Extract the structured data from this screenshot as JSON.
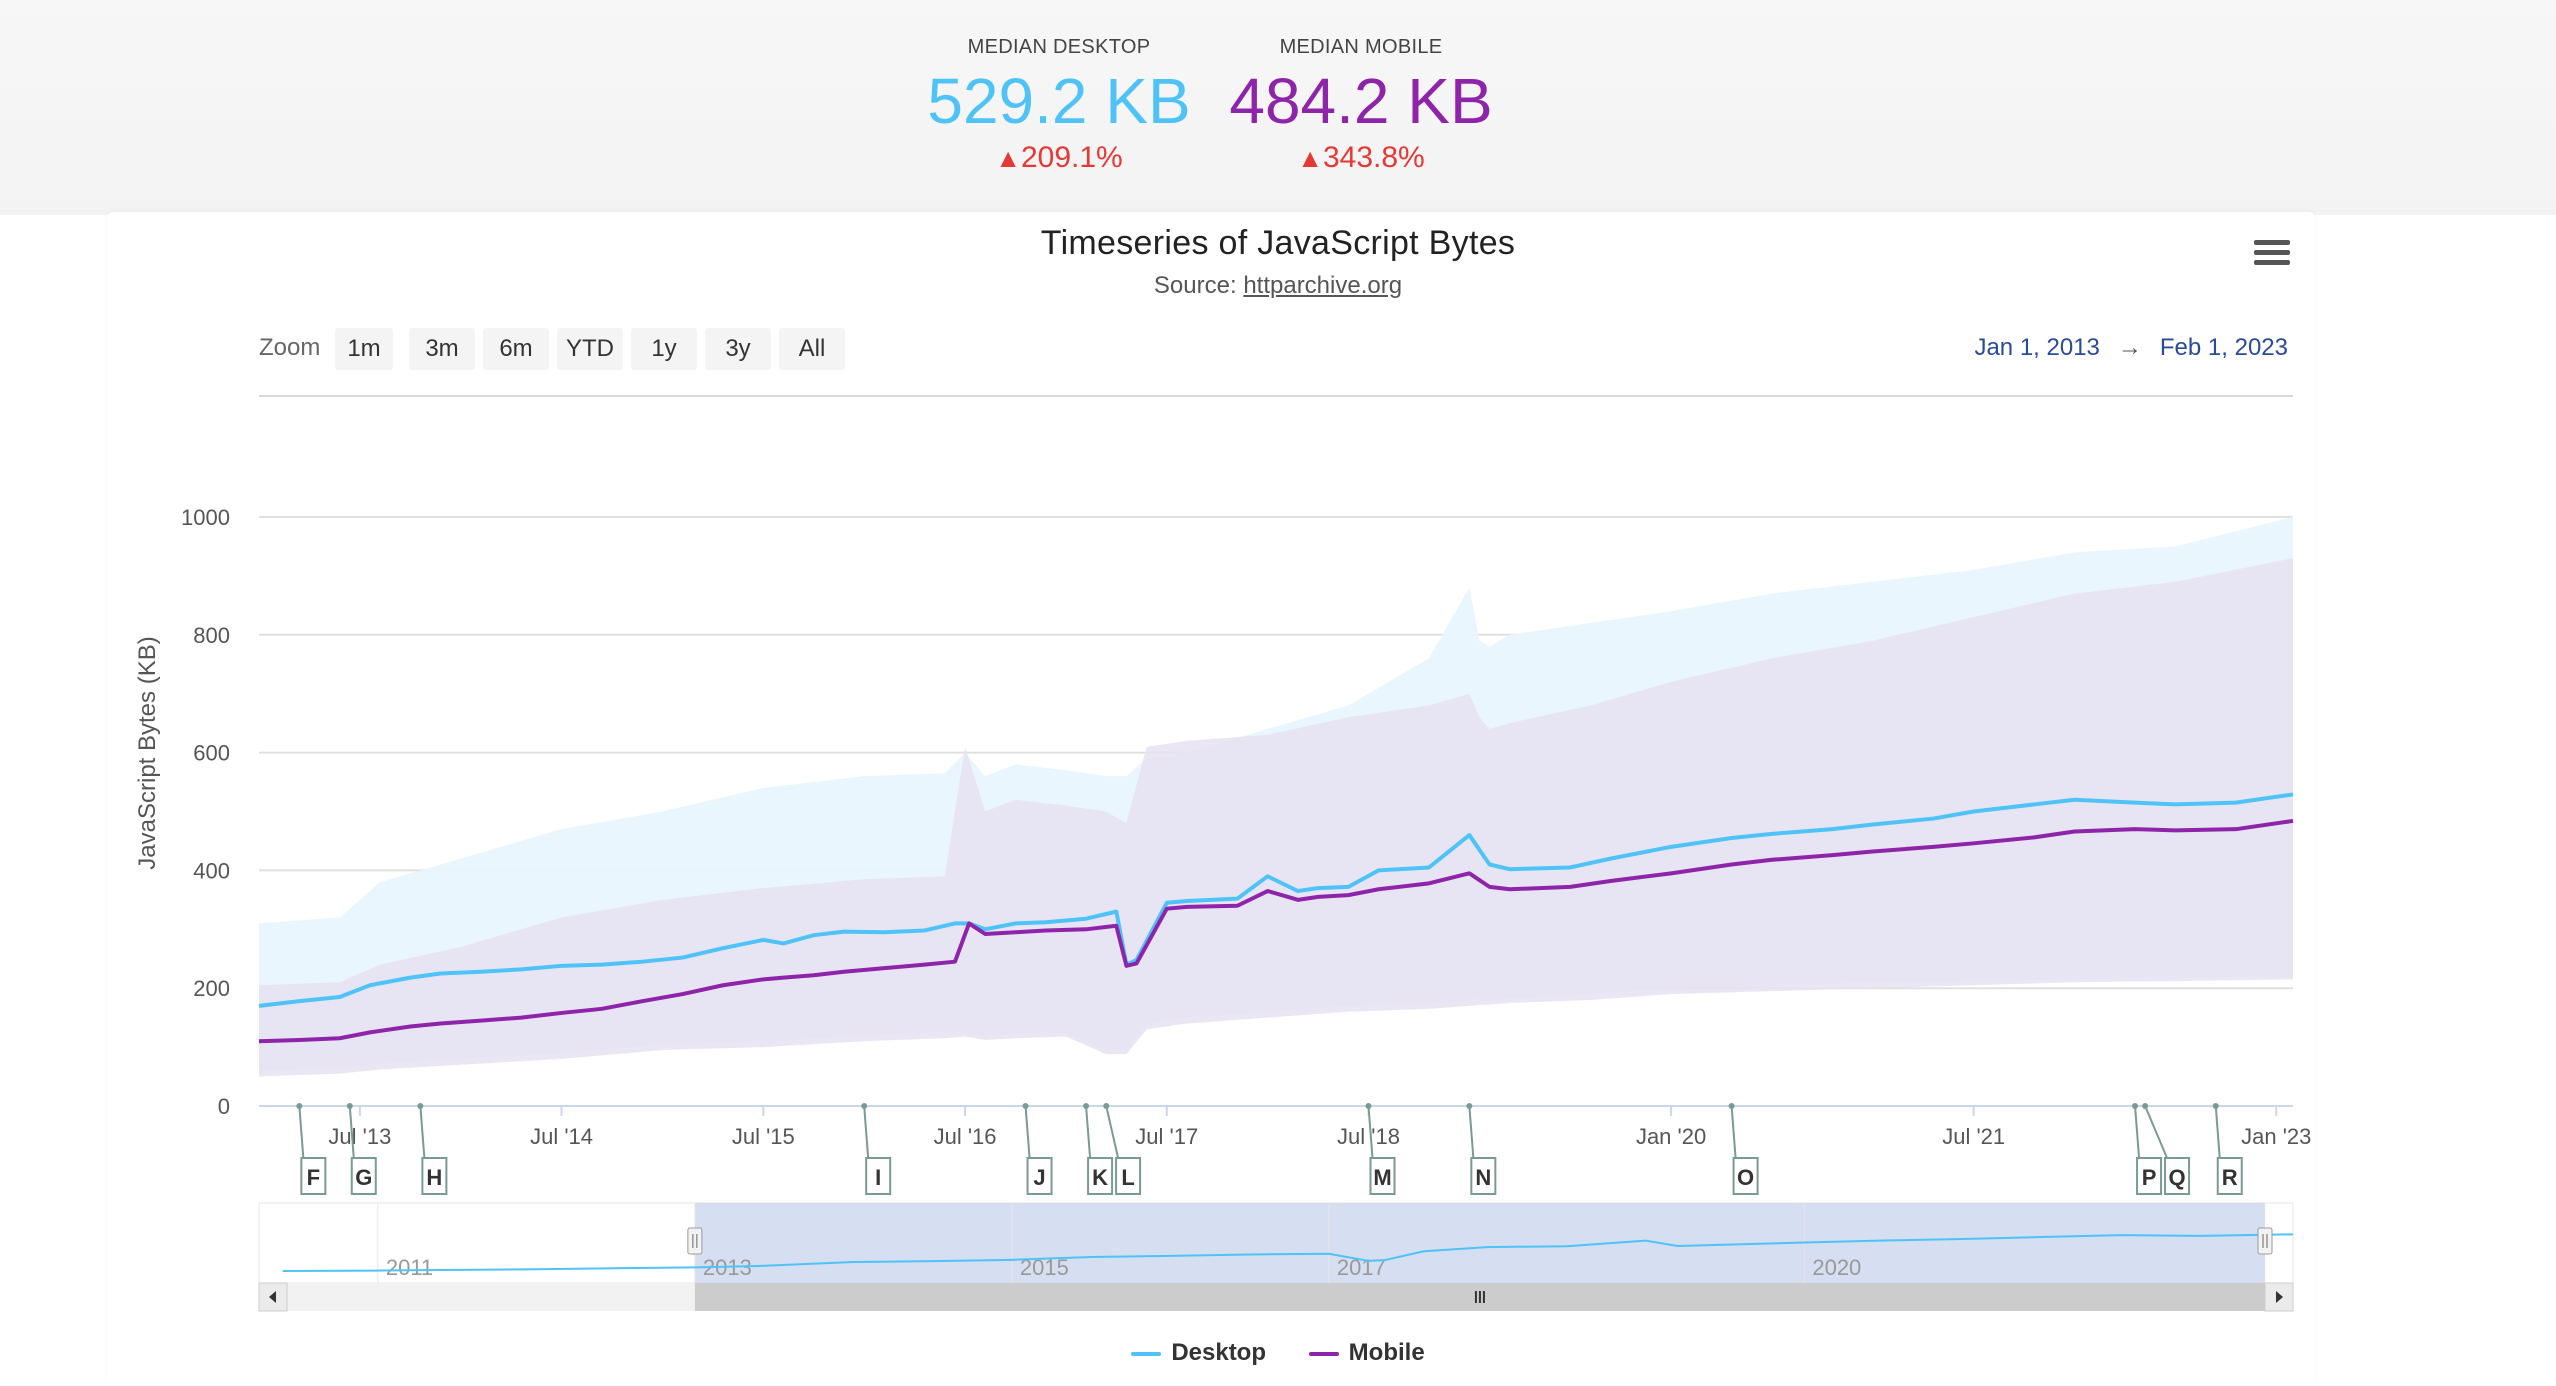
{
  "metrics": {
    "desktop": {
      "label": "MEDIAN DESKTOP",
      "value": "529.2 KB",
      "change": "209.1%"
    },
    "mobile": {
      "label": "MEDIAN MOBILE",
      "value": "484.2 KB",
      "change": "343.8%"
    }
  },
  "colors": {
    "desktop": "#4fc3f7",
    "mobile": "#8e24aa",
    "desktop_band": "#e8f6fd",
    "mobile_band": "#e6e2f2",
    "change_up": "#e53935",
    "navigator_fill": "#cfd8ee"
  },
  "chart": {
    "title": "Timeseries of JavaScript Bytes",
    "source_prefix": "Source: ",
    "source_link": "httparchive.org",
    "zoom_label": "Zoom",
    "zoom_buttons": [
      "1m",
      "3m",
      "6m",
      "YTD",
      "1y",
      "3y",
      "All"
    ],
    "range_from": "Jan 1, 2013",
    "range_arrow": "→",
    "range_to": "Feb 1, 2023",
    "menu_icon": "hamburger-menu-icon",
    "navigator_handle_icon": "grip-handle-icon",
    "scroll_left_icon": "scroll-left-arrow-icon",
    "scroll_right_icon": "scroll-right-arrow-icon",
    "scroll_grip_icon": "scroll-grip-icon"
  },
  "chart_data": {
    "type": "line",
    "title": "Timeseries of JavaScript Bytes",
    "ylabel": "JavaScript Bytes (KB)",
    "xlabel": "",
    "ylim": [
      0,
      1000
    ],
    "xlim": [
      2013.0,
      2023.083
    ],
    "yticks": [
      0,
      200,
      400,
      600,
      800,
      1000
    ],
    "xticks": [
      {
        "x": 2013.5,
        "label": "Jul '13"
      },
      {
        "x": 2014.5,
        "label": "Jul '14"
      },
      {
        "x": 2015.5,
        "label": "Jul '15"
      },
      {
        "x": 2016.5,
        "label": "Jul '16"
      },
      {
        "x": 2017.5,
        "label": "Jul '17"
      },
      {
        "x": 2018.5,
        "label": "Jul '18"
      },
      {
        "x": 2020.0,
        "label": "Jan '20"
      },
      {
        "x": 2021.5,
        "label": "Jul '21"
      },
      {
        "x": 2023.0,
        "label": "Jan '23"
      }
    ],
    "grid": true,
    "legend_position": "bottom-center",
    "series": [
      {
        "name": "Desktop",
        "x": [
          2013.0,
          2013.2,
          2013.4,
          2013.55,
          2013.75,
          2013.9,
          2014.1,
          2014.3,
          2014.5,
          2014.7,
          2014.9,
          2015.1,
          2015.3,
          2015.5,
          2015.6,
          2015.75,
          2015.9,
          2016.1,
          2016.3,
          2016.45,
          2016.52,
          2016.6,
          2016.75,
          2016.9,
          2017.1,
          2017.25,
          2017.3,
          2017.35,
          2017.5,
          2017.6,
          2017.85,
          2018.0,
          2018.15,
          2018.25,
          2018.4,
          2018.55,
          2018.8,
          2019.0,
          2019.1,
          2019.2,
          2019.5,
          2019.7,
          2020.0,
          2020.3,
          2020.5,
          2020.8,
          2021.0,
          2021.3,
          2021.5,
          2021.8,
          2022.0,
          2022.3,
          2022.5,
          2022.8,
          2023.083
        ],
        "y": [
          170,
          178,
          185,
          205,
          218,
          225,
          228,
          232,
          238,
          240,
          245,
          252,
          268,
          282,
          276,
          290,
          296,
          295,
          298,
          310,
          310,
          300,
          310,
          312,
          318,
          330,
          240,
          248,
          345,
          348,
          352,
          390,
          365,
          370,
          372,
          400,
          405,
          460,
          410,
          402,
          405,
          420,
          440,
          455,
          462,
          470,
          478,
          488,
          500,
          512,
          520,
          515,
          512,
          515,
          529
        ]
      },
      {
        "name": "Mobile",
        "x": [
          2013.0,
          2013.2,
          2013.4,
          2013.55,
          2013.75,
          2013.9,
          2014.1,
          2014.3,
          2014.5,
          2014.7,
          2014.9,
          2015.1,
          2015.3,
          2015.5,
          2015.6,
          2015.75,
          2015.9,
          2016.1,
          2016.3,
          2016.45,
          2016.52,
          2016.6,
          2016.75,
          2016.9,
          2017.1,
          2017.25,
          2017.3,
          2017.35,
          2017.5,
          2017.6,
          2017.85,
          2018.0,
          2018.15,
          2018.25,
          2018.4,
          2018.55,
          2018.8,
          2019.0,
          2019.1,
          2019.2,
          2019.5,
          2019.7,
          2020.0,
          2020.3,
          2020.5,
          2020.8,
          2021.0,
          2021.3,
          2021.5,
          2021.8,
          2022.0,
          2022.3,
          2022.5,
          2022.8,
          2023.083
        ],
        "y": [
          110,
          112,
          115,
          125,
          135,
          140,
          145,
          150,
          158,
          165,
          178,
          190,
          205,
          215,
          218,
          222,
          228,
          234,
          240,
          245,
          310,
          292,
          295,
          298,
          300,
          306,
          238,
          242,
          335,
          338,
          340,
          365,
          350,
          355,
          358,
          368,
          378,
          395,
          372,
          368,
          372,
          382,
          395,
          410,
          418,
          426,
          432,
          440,
          446,
          456,
          466,
          470,
          468,
          470,
          484
        ]
      }
    ],
    "bands": [
      {
        "series": "Desktop",
        "x": [
          2013.0,
          2013.4,
          2013.6,
          2014.0,
          2014.5,
          2015.0,
          2015.5,
          2016.0,
          2016.4,
          2016.5,
          2016.6,
          2016.75,
          2017.0,
          2017.2,
          2017.3,
          2017.4,
          2017.6,
          2018.0,
          2018.4,
          2018.8,
          2019.0,
          2019.05,
          2019.1,
          2019.2,
          2019.6,
          2020.0,
          2020.5,
          2021.0,
          2021.5,
          2022.0,
          2022.5,
          2023.083
        ],
        "high": [
          310,
          320,
          380,
          420,
          470,
          500,
          540,
          560,
          565,
          600,
          560,
          580,
          570,
          560,
          560,
          590,
          600,
          640,
          680,
          760,
          880,
          790,
          780,
          800,
          820,
          840,
          870,
          890,
          910,
          940,
          950,
          1000
        ],
        "low": [
          60,
          65,
          72,
          80,
          90,
          105,
          110,
          120,
          125,
          125,
          120,
          122,
          125,
          95,
          95,
          140,
          150,
          160,
          170,
          175,
          180,
          182,
          180,
          182,
          190,
          200,
          205,
          210,
          212,
          215,
          218,
          220
        ]
      },
      {
        "series": "Mobile",
        "x": [
          2013.0,
          2013.4,
          2013.6,
          2014.0,
          2014.5,
          2015.0,
          2015.5,
          2016.0,
          2016.4,
          2016.5,
          2016.6,
          2016.75,
          2017.0,
          2017.2,
          2017.3,
          2017.4,
          2017.6,
          2018.0,
          2018.4,
          2018.8,
          2019.0,
          2019.05,
          2019.1,
          2019.2,
          2019.6,
          2020.0,
          2020.5,
          2021.0,
          2021.5,
          2022.0,
          2022.5,
          2023.083
        ],
        "high": [
          205,
          210,
          240,
          270,
          320,
          350,
          370,
          385,
          390,
          610,
          500,
          520,
          510,
          500,
          480,
          610,
          620,
          630,
          660,
          680,
          700,
          660,
          640,
          650,
          680,
          720,
          760,
          790,
          830,
          870,
          890,
          930
        ],
        "low": [
          50,
          55,
          62,
          70,
          80,
          95,
          100,
          110,
          115,
          118,
          112,
          115,
          118,
          88,
          88,
          130,
          140,
          150,
          160,
          165,
          170,
          172,
          172,
          175,
          180,
          190,
          195,
          200,
          205,
          210,
          212,
          215
        ]
      }
    ]
  },
  "flags": [
    {
      "x": 2013.2,
      "label": "F"
    },
    {
      "x": 2013.45,
      "label": "G"
    },
    {
      "x": 2013.8,
      "label": "H"
    },
    {
      "x": 2016.0,
      "label": "I"
    },
    {
      "x": 2016.8,
      "label": "J"
    },
    {
      "x": 2017.1,
      "label": "K"
    },
    {
      "x": 2017.2,
      "label": "L"
    },
    {
      "x": 2018.5,
      "label": "M"
    },
    {
      "x": 2019.0,
      "label": "N"
    },
    {
      "x": 2020.3,
      "label": "O"
    },
    {
      "x": 2022.3,
      "label": "P"
    },
    {
      "x": 2022.35,
      "label": "Q"
    },
    {
      "x": 2022.7,
      "label": "R"
    }
  ],
  "navigator": {
    "xlim": [
      2010.25,
      2023.083
    ],
    "selected": [
      2013.0,
      2023.083
    ],
    "labels": [
      {
        "x": 2011.0,
        "label": "2011"
      },
      {
        "x": 2013.0,
        "label": "2013"
      },
      {
        "x": 2015.0,
        "label": "2015"
      },
      {
        "x": 2017.0,
        "label": "2017"
      },
      {
        "x": 2020.0,
        "label": "2020"
      }
    ],
    "preview_x": [
      2010.4,
      2011.0,
      2011.5,
      2012.0,
      2012.5,
      2013.0,
      2013.4,
      2014.0,
      2014.5,
      2015.0,
      2015.5,
      2016.0,
      2016.5,
      2017.0,
      2017.25,
      2017.35,
      2017.6,
      2018.0,
      2018.5,
      2019.0,
      2019.2,
      2020.0,
      2020.5,
      2021.0,
      2021.5,
      2022.0,
      2022.5,
      2023.083
    ],
    "preview_y": [
      130,
      135,
      142,
      150,
      160,
      170,
      185,
      228,
      238,
      252,
      282,
      295,
      310,
      318,
      240,
      248,
      345,
      390,
      400,
      460,
      402,
      440,
      462,
      478,
      500,
      520,
      512,
      529
    ]
  },
  "legend": {
    "desktop_label": "Desktop",
    "mobile_label": "Mobile"
  }
}
